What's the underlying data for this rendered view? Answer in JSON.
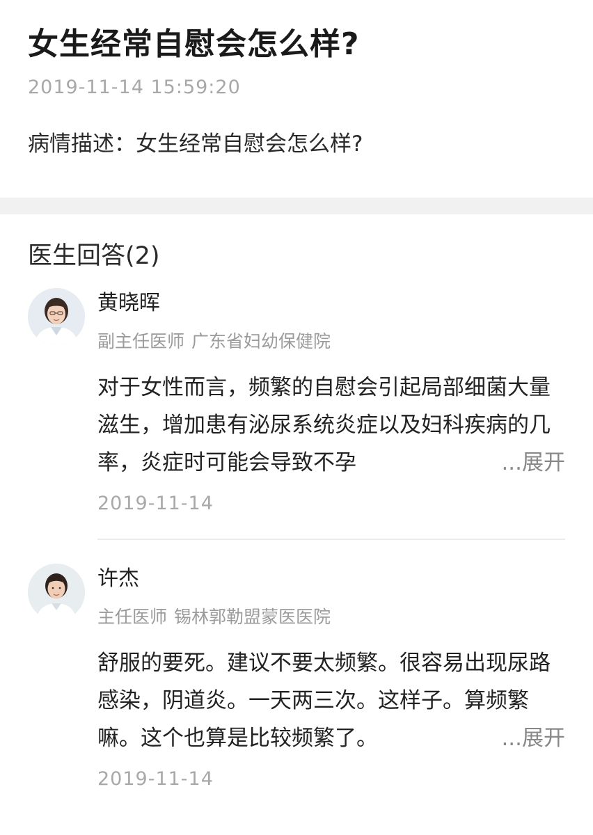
{
  "question": {
    "title": "女生经常自慰会怎么样?",
    "time": "2019-11-14 15:59:20",
    "description": "病情描述：女生经常自慰会怎么样?"
  },
  "answers_section": {
    "heading": "医生回答(2)"
  },
  "answers": [
    {
      "doctor_name": "黄晓晖",
      "title": "副主任医师",
      "hospital": "广东省妇幼保健院",
      "text": "对于女性而言，频繁的自慰会引起局部细菌大量滋生，增加患有泌尿系统炎症以及妇科疾病的几率，炎症时可能会导致不孕",
      "expand_label": "...展开",
      "date": "2019-11-14"
    },
    {
      "doctor_name": "许杰",
      "title": "主任医师",
      "hospital": "锡林郭勒盟蒙医医院",
      "text": "舒服的要死。建议不要太频繁。很容易出现尿路感染，阴道炎。一天两三次。这样子。算频繁嘛。这个也算是比较频繁了。",
      "expand_label": "...展开",
      "date": "2019-11-14"
    }
  ],
  "colors": {
    "title": "#1a1a1a",
    "muted": "#a8a8a8",
    "band": "#f1f1f1",
    "expand": "#888888"
  }
}
